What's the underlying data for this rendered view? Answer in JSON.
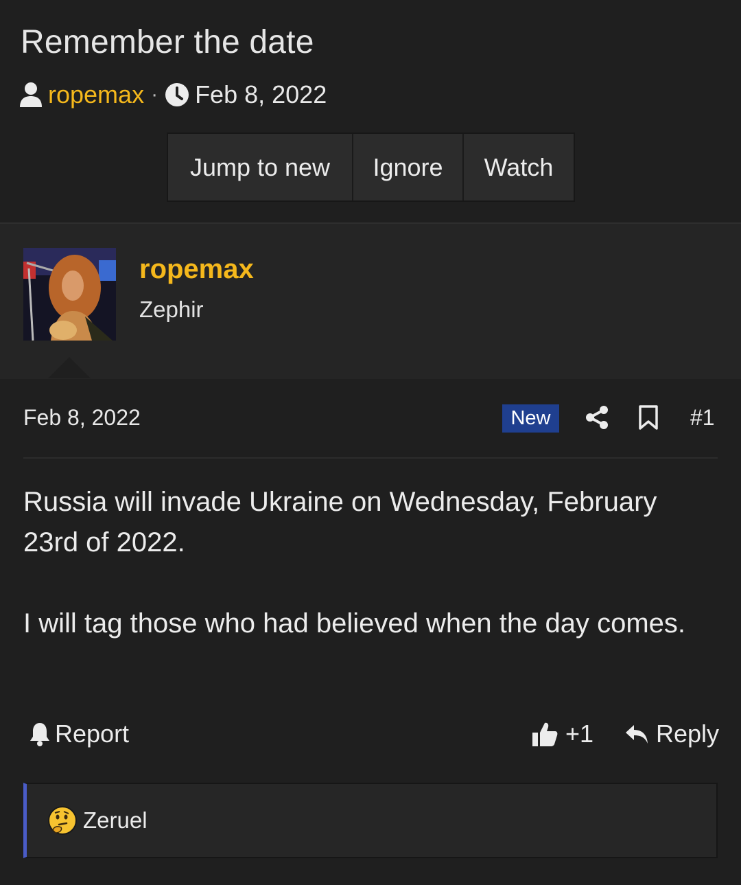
{
  "thread": {
    "title": "Remember the date",
    "author": "ropemax",
    "separator": "·",
    "date": "Feb 8, 2022"
  },
  "actions": {
    "jump_label": "Jump to new",
    "ignore_label": "Ignore",
    "watch_label": "Watch"
  },
  "post": {
    "username": "ropemax",
    "user_title": "Zephir",
    "date": "Feb 8, 2022",
    "badge": "New",
    "number": "#1",
    "paragraphs": [
      "Russia will invade Ukraine on Wednesday, February 23rd of 2022.",
      "I will tag those who had believed when the day comes."
    ],
    "report_label": "Report",
    "like_count": "+1",
    "reply_label": "Reply",
    "reaction_user": "Zeruel"
  },
  "colors": {
    "accent": "#f5b81c",
    "badge_bg": "#1f3f8f",
    "reaction_bar": "#4a5cc7"
  },
  "icons": [
    "user-icon",
    "clock-icon",
    "share-icon",
    "bookmark-icon",
    "bell-icon",
    "thumbs-up-icon",
    "reply-arrow-icon",
    "thinking-face-icon"
  ]
}
